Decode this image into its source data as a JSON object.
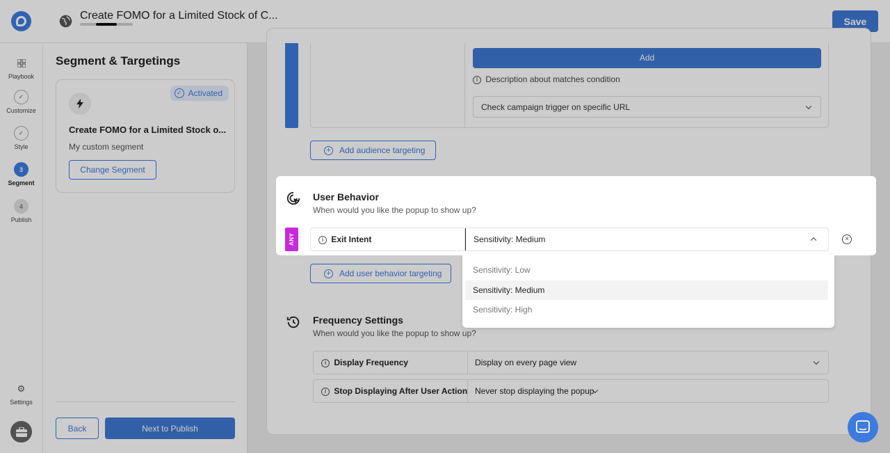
{
  "header": {
    "title": "Create FOMO for a Limited Stock of C...",
    "progress": 0.7,
    "save_label": "Save"
  },
  "rail": {
    "items": [
      {
        "label": "Playbook",
        "icon": "grid-icon"
      },
      {
        "label": "Customize",
        "icon": "check-circle-icon"
      },
      {
        "label": "Style",
        "icon": "check-circle-icon"
      },
      {
        "label": "Segment",
        "step": "3"
      },
      {
        "label": "Publish",
        "step": "4"
      }
    ],
    "settings_label": "Settings"
  },
  "left_panel": {
    "title": "Segment & Targetings",
    "segment": {
      "badge": "Activated",
      "name": "Create FOMO for a Limited Stock o...",
      "description": "My custom segment",
      "change_label": "Change Segment"
    },
    "back_label": "Back",
    "next_label": "Next to Publish"
  },
  "audience": {
    "add_label": "Add",
    "description": "Description about matches condition",
    "url_select": "Check campaign trigger on specific URL",
    "add_targeting_label": "Add audience targeting"
  },
  "user_behavior": {
    "title": "User Behavior",
    "subtitle": "When would you like the popup to show up?",
    "badge": "ANY",
    "condition_label": "Exit Intent",
    "sensitivity_value": "Sensitivity: Medium",
    "add_targeting_label": "Add user behavior targeting",
    "options": [
      "Sensitivity: Low",
      "Sensitivity: Medium",
      "Sensitivity: High"
    ]
  },
  "frequency": {
    "title": "Frequency Settings",
    "subtitle": "When would you like the popup to show up?",
    "display_label": "Display Frequency",
    "display_value": "Display on every page view",
    "stop_label": "Stop Displaying After User Action",
    "stop_value": "Never stop displaying the popup"
  },
  "colors": {
    "primary": "#3e7bdf",
    "any_badge": "#c62bd9"
  }
}
